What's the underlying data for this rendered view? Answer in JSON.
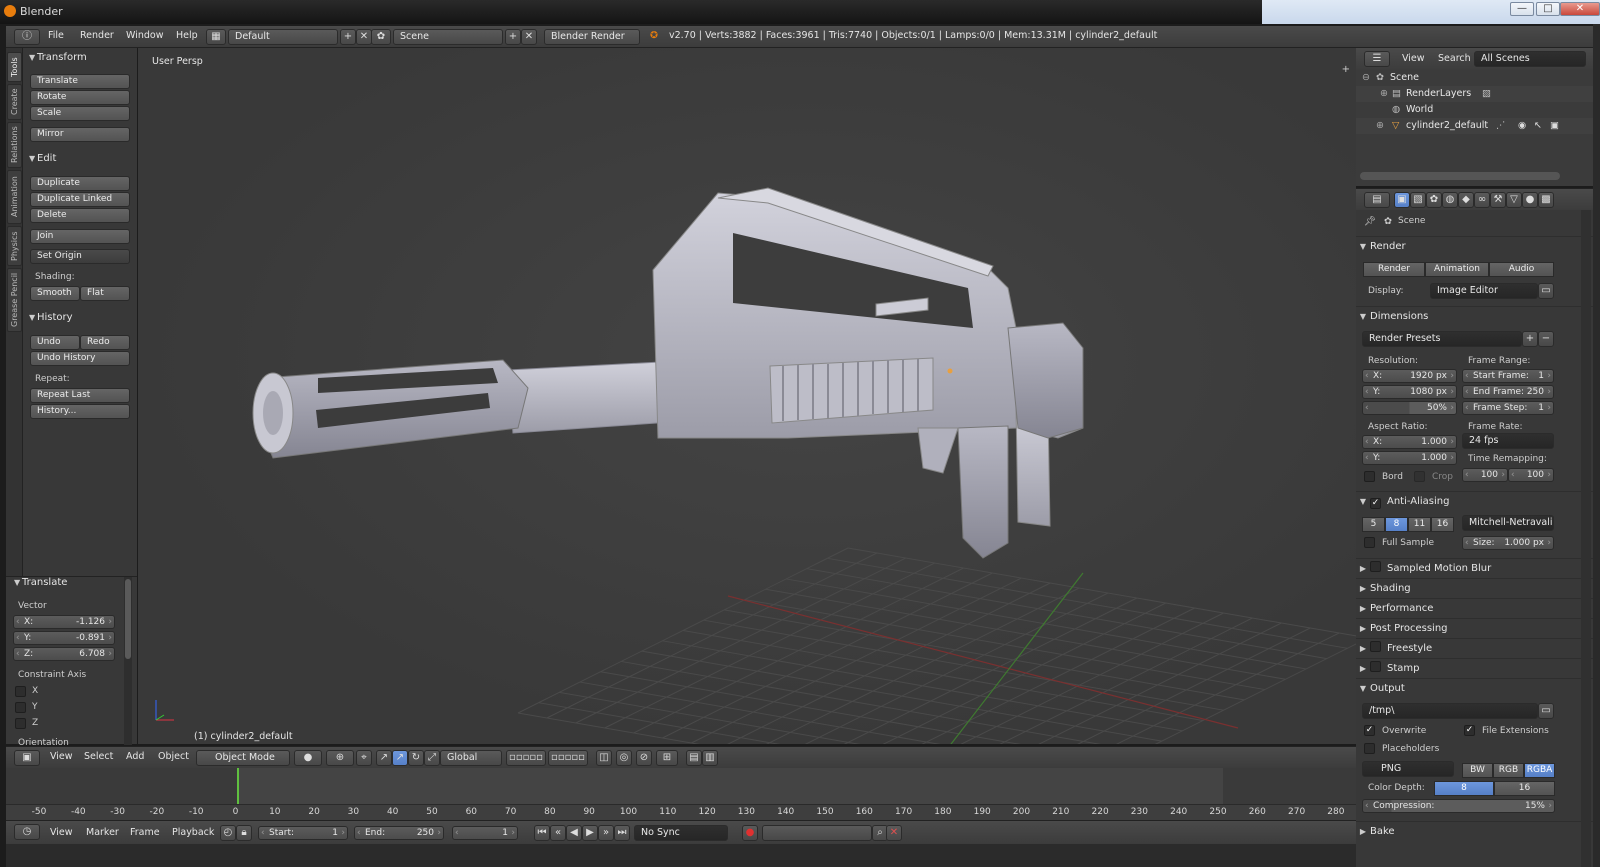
{
  "window": {
    "title": "Blender",
    "min": "—",
    "max": "□",
    "close": "✕"
  },
  "menu": {
    "items": [
      "File",
      "Render",
      "Window",
      "Help"
    ],
    "layout": "Default",
    "scene": "Scene",
    "engine": "Blender Render",
    "info": "v2.70 | Verts:3882 | Faces:3961 | Tris:7740 | Objects:0/1 | Lamps:0/0 | Mem:13.31M | cylinder2_default"
  },
  "tabs": [
    "Tools",
    "Create",
    "Relations",
    "Animation",
    "Physics",
    "Grease Pencil"
  ],
  "toolshelf": {
    "transform_title": "Transform",
    "transform": [
      "Translate",
      "Rotate",
      "Scale"
    ],
    "mirror": "Mirror",
    "edit_title": "Edit",
    "edit": [
      "Duplicate",
      "Duplicate Linked",
      "Delete"
    ],
    "join": "Join",
    "set_origin": "Set Origin",
    "shading_label": "Shading:",
    "smooth": "Smooth",
    "flat": "Flat",
    "history_title": "History",
    "undo": "Undo",
    "redo": "Redo",
    "undo_history": "Undo History",
    "repeat_label": "Repeat:",
    "repeat_last": "Repeat Last",
    "history_btn": "History..."
  },
  "redo_panel": {
    "title": "Translate",
    "vector_label": "Vector",
    "x_k": "X:",
    "x_v": "-1.126",
    "y_k": "Y:",
    "y_v": "-0.891",
    "z_k": "Z:",
    "z_v": "6.708",
    "constraint_label": "Constraint Axis",
    "cx": "X",
    "cy": "Y",
    "cz": "Z",
    "orientation_label": "Orientation"
  },
  "viewport": {
    "view_label": "User Persp",
    "object_label": "(1) cylinder2_default"
  },
  "view3d_header": {
    "view": "View",
    "select": "Select",
    "add": "Add",
    "object": "Object",
    "mode": "Object Mode",
    "orientation": "Global"
  },
  "timeline": {
    "ticks": [
      "-50",
      "-40",
      "-30",
      "-20",
      "-10",
      "0",
      "10",
      "20",
      "30",
      "40",
      "50",
      "60",
      "70",
      "80",
      "90",
      "100",
      "110",
      "120",
      "130",
      "140",
      "150",
      "160",
      "170",
      "180",
      "190",
      "200",
      "210",
      "220",
      "230",
      "240",
      "250",
      "260",
      "270",
      "280"
    ],
    "view": "View",
    "marker": "Marker",
    "frame": "Frame",
    "playback": "Playback",
    "start_k": "Start:",
    "start_v": "1",
    "end_k": "End:",
    "end_v": "250",
    "current": "1",
    "sync": "No Sync"
  },
  "outliner": {
    "view": "View",
    "search": "Search",
    "scope": "All Scenes",
    "rows": [
      "Scene",
      "RenderLayers",
      "World",
      "cylinder2_default"
    ]
  },
  "properties": {
    "context": "Scene",
    "render_title": "Render",
    "render_btn": "Render",
    "animation_btn": "Animation",
    "audio_btn": "Audio",
    "display_label": "Display:",
    "display_value": "Image Editor",
    "dimensions_title": "Dimensions",
    "presets": "Render Presets",
    "resolution_label": "Resolution:",
    "res_x_k": "X:",
    "res_x_v": "1920 px",
    "res_y_k": "Y:",
    "res_y_v": "1080 px",
    "res_pct": "50%",
    "frame_range_label": "Frame Range:",
    "start_k": "Start Frame:",
    "start_v": "1",
    "end_k": "End Frame:",
    "end_v": "250",
    "step_k": "Frame Step:",
    "step_v": "1",
    "aspect_label": "Aspect Ratio:",
    "asp_x_k": "X:",
    "asp_x_v": "1.000",
    "asp_y_k": "Y:",
    "asp_y_v": "1.000",
    "frame_rate_label": "Frame Rate:",
    "fps": "24 fps",
    "time_remap_label": "Time Remapping:",
    "remap_old": "100",
    "remap_new": "100",
    "bord": "Bord",
    "crop": "Crop",
    "aa_title": "Anti-Aliasing",
    "aa_levels": [
      "5",
      "8",
      "11",
      "16"
    ],
    "aa_filter": "Mitchell-Netravali",
    "full_sample": "Full Sample",
    "size_k": "Size:",
    "size_v": "1.000 px",
    "smb": "Sampled Motion Blur",
    "shading": "Shading",
    "performance": "Performance",
    "post": "Post Processing",
    "freestyle": "Freestyle",
    "stamp": "Stamp",
    "output_title": "Output",
    "output_path": "/tmp\\",
    "overwrite": "Overwrite",
    "file_ext": "File Extensions",
    "placeholders": "Placeholders",
    "format": "PNG",
    "bw": "BW",
    "rgb": "RGB",
    "rgba": "RGBA",
    "depth_label": "Color Depth:",
    "depth_8": "8",
    "depth_16": "16",
    "compression_k": "Compression:",
    "compression_v": "15%",
    "bake": "Bake"
  },
  "colors": {
    "accent": "#5680c8",
    "background": "#393939",
    "current_frame": "#60c040"
  }
}
